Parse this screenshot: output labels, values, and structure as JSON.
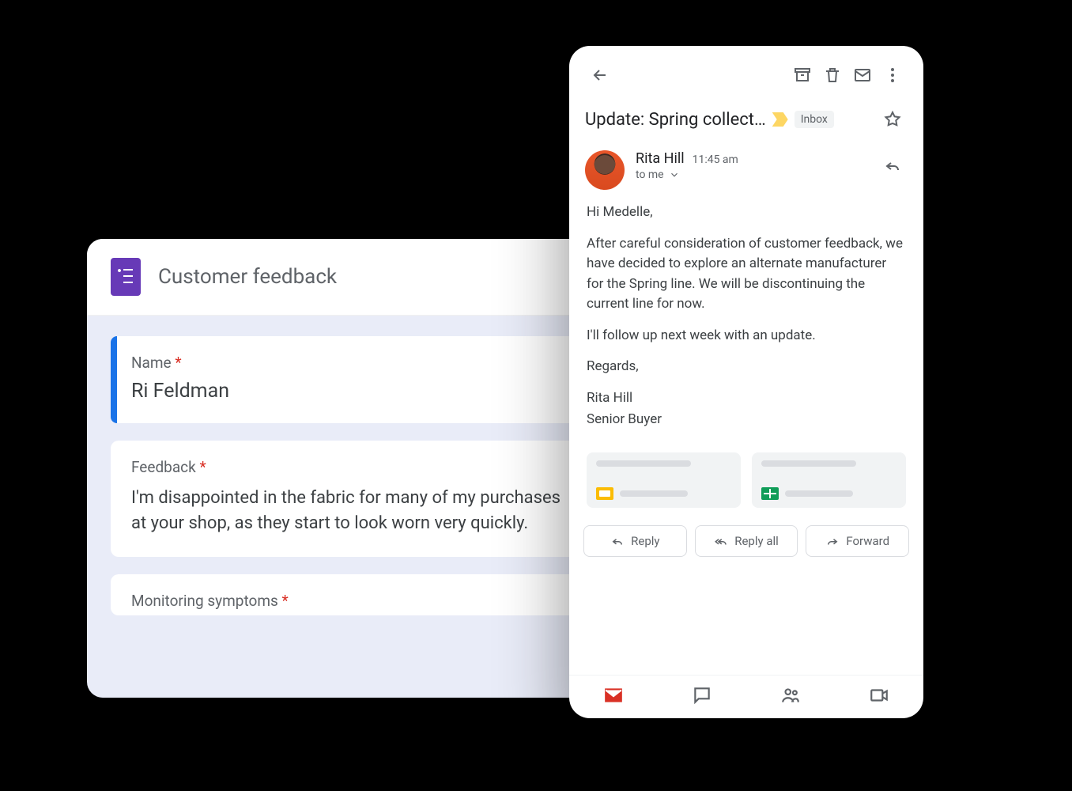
{
  "forms": {
    "title": "Customer feedback",
    "questions": [
      {
        "label": "Name",
        "required": true,
        "value": "Ri Feldman"
      },
      {
        "label": "Feedback",
        "required": true,
        "text": "I'm disappointed in the fabric for many of my purchases at your shop, as they start to look worn very quickly."
      },
      {
        "label": "Monitoring symptoms",
        "required": true
      }
    ]
  },
  "gmail": {
    "subject": "Update: Spring collect…",
    "label_chip": "Inbox",
    "sender": {
      "name": "Rita Hill",
      "time": "11:45 am",
      "to": "to me"
    },
    "body": {
      "greeting": "Hi Medelle,",
      "p1": "After careful consideration of customer feedback, we have decided to explore an alternate manufacturer for the Spring line. We will be discontinuing the current line for now.",
      "p2": "I'll follow up next week with an update.",
      "closing": "Regards,",
      "sig_name": "Rita Hill",
      "sig_title": "Senior Buyer"
    },
    "actions": {
      "reply": "Reply",
      "reply_all": "Reply all",
      "forward": "Forward"
    }
  }
}
